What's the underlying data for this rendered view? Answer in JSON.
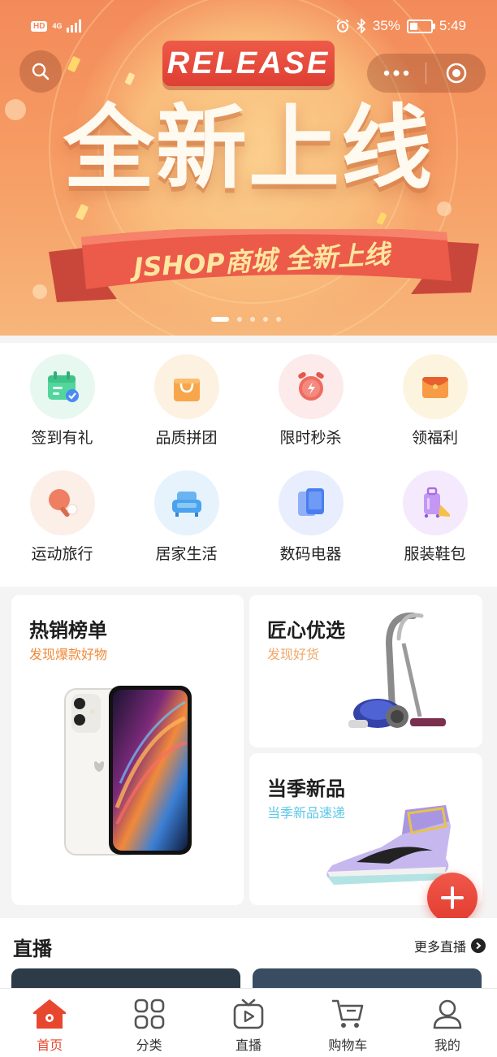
{
  "status_bar": {
    "hd": "HD",
    "network": "4G",
    "battery": "35%",
    "time": "5:49"
  },
  "banner": {
    "tag": "RELEASE",
    "headline": "全新上线",
    "ribbon_text": "JSHOP商城 全新上线",
    "slide_count": 5,
    "active_slide": 0
  },
  "categories": [
    {
      "label": "签到有礼",
      "icon": "calendar-check-icon",
      "bg": "#e7f8f0",
      "color": "#4fd39a"
    },
    {
      "label": "品质拼团",
      "icon": "shopping-bag-icon",
      "bg": "#fdf1e2",
      "color": "#f7a64b"
    },
    {
      "label": "限时秒杀",
      "icon": "alarm-clock-icon",
      "bg": "#fdeaea",
      "color": "#ef6b60"
    },
    {
      "label": "领福利",
      "icon": "red-envelope-icon",
      "bg": "#fdf4e0",
      "color": "#f79b46"
    },
    {
      "label": "运动旅行",
      "icon": "ping-pong-icon",
      "bg": "#fbefe8",
      "color": "#ef7f62"
    },
    {
      "label": "居家生活",
      "icon": "sofa-icon",
      "bg": "#e6f3fd",
      "color": "#4aa3ee"
    },
    {
      "label": "数码电器",
      "icon": "phone-icon",
      "bg": "#e8eefd",
      "color": "#4a7ef0"
    },
    {
      "label": "服装鞋包",
      "icon": "suitcase-shoe-icon",
      "bg": "#f5eafd",
      "color": "#b77ef0"
    }
  ],
  "features": {
    "hot": {
      "title": "热销榜单",
      "subtitle": "发现爆款好物",
      "subtitle_color": "#f08a3c"
    },
    "craft": {
      "title": "匠心优选",
      "subtitle": "发现好货",
      "subtitle_color": "#f2a86a"
    },
    "season": {
      "title": "当季新品",
      "subtitle": "当季新品速递",
      "subtitle_color": "#5cc7e8"
    }
  },
  "live": {
    "title": "直播",
    "more": "更多直播"
  },
  "tabs": [
    {
      "label": "首页",
      "icon": "home-icon",
      "active": true
    },
    {
      "label": "分类",
      "icon": "grid-icon",
      "active": false
    },
    {
      "label": "直播",
      "icon": "tv-play-icon",
      "active": false
    },
    {
      "label": "购物车",
      "icon": "cart-icon",
      "active": false
    },
    {
      "label": "我的",
      "icon": "user-icon",
      "active": false
    }
  ],
  "accent_color": "#e8472f"
}
